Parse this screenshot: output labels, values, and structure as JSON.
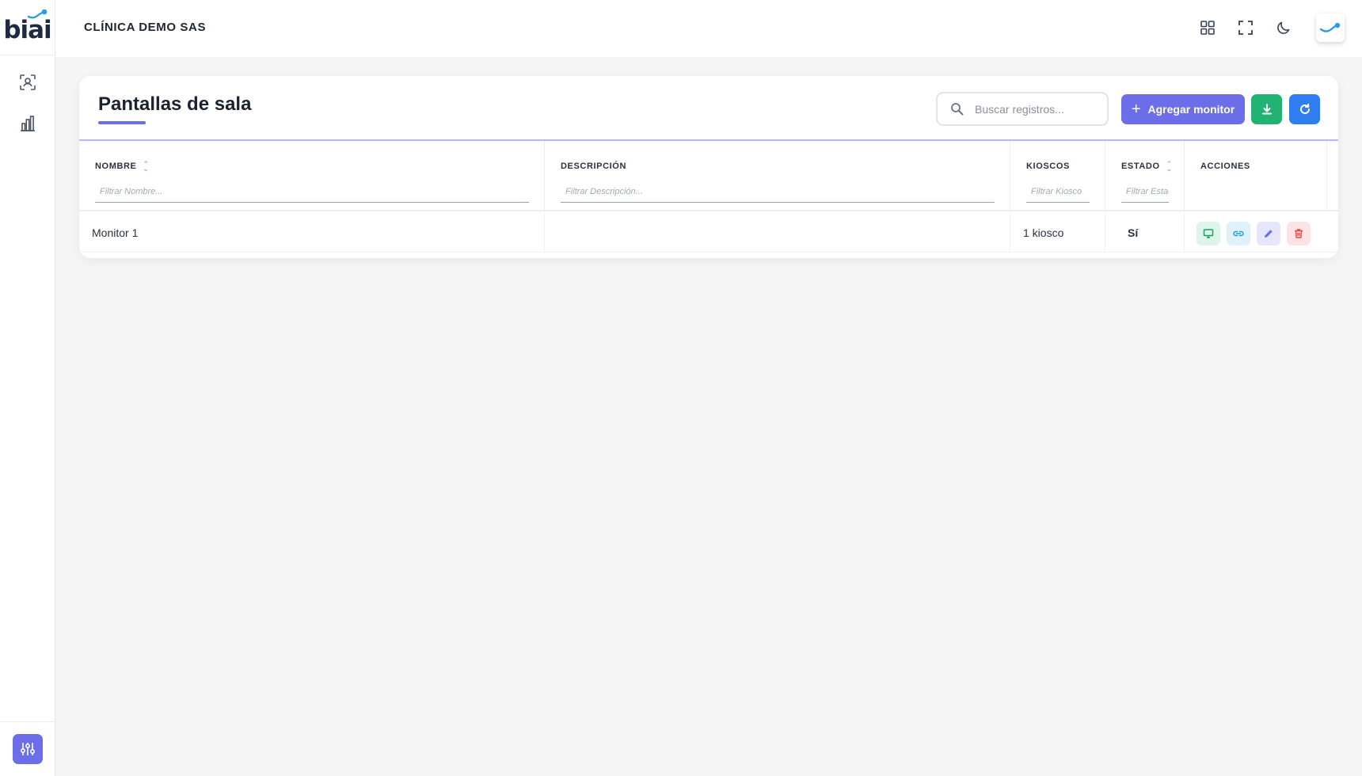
{
  "brand": {
    "logo_text": "biai"
  },
  "sidebar": {
    "items": [
      {
        "name": "patients-scan-icon"
      },
      {
        "name": "reports-chart-icon"
      }
    ],
    "settings_icon": "sliders-icon"
  },
  "header": {
    "company": "CLÍNICA DEMO SAS",
    "icons": [
      "apps-grid-icon",
      "fullscreen-icon",
      "dark-mode-moon-icon"
    ]
  },
  "page": {
    "title": "Pantallas de sala",
    "search_placeholder": "Buscar registros...",
    "add_button_label": "Agregar monitor"
  },
  "table": {
    "columns": [
      {
        "key": "nombre",
        "label": "NOMBRE",
        "sortable": true,
        "filter_placeholder": "Filtrar Nombre..."
      },
      {
        "key": "descripcion",
        "label": "DESCRIPCIÓN",
        "sortable": false,
        "filter_placeholder": "Filtrar Descripción..."
      },
      {
        "key": "kioscos",
        "label": "KIOSCOS",
        "sortable": false,
        "filter_placeholder": "Filtrar Kiosco"
      },
      {
        "key": "estado",
        "label": "ESTADO",
        "sortable": true,
        "filter_placeholder": "Filtrar Estado"
      },
      {
        "key": "acciones",
        "label": "ACCIONES",
        "sortable": false
      }
    ],
    "rows": [
      {
        "nombre": "Monitor 1",
        "descripcion": "",
        "kioscos": "1 kiosco",
        "estado": "Sí"
      }
    ]
  },
  "colors": {
    "primary": "#6c6de8",
    "success": "#22b273",
    "info": "#2f7df0",
    "danger": "#ef4444"
  }
}
